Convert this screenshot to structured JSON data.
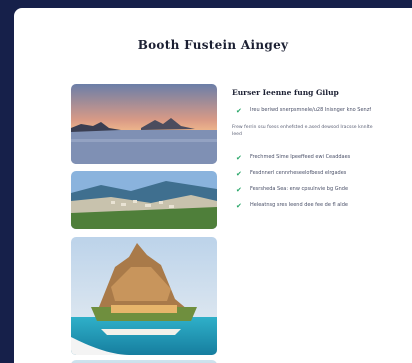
{
  "page": {
    "title": "Booth Fustein Aingey"
  },
  "section": {
    "heading": "Eurser Ieenne fung Gilup",
    "intro_item": "Ireu beriwd snerpsmnele/u28 Inisnger kno Senzf",
    "description": "Frew ferrin ssu fsess enhefsted e.ased dewsod Iracsse knnIte Ieed",
    "features": [
      "Frechmed Sime Ipeeffeed ewi Ceaddaes",
      "Fesdnnerl cennrheseelofbesd elrgades",
      "Fesrsheda Sea: enw cpsulnvie bg Gnde",
      "Heleatnsg sres Ieend dee fee de fl alde"
    ]
  },
  "images": [
    {
      "name": "sunset-lake-photo"
    },
    {
      "name": "coastal-town-photo"
    },
    {
      "name": "island-temple-resort-photo"
    },
    {
      "name": "fourth-photo-partial"
    }
  ],
  "colors": {
    "background": "#16204a",
    "card": "#ffffff",
    "accent_check": "#25a566",
    "text_dark": "#1c2033"
  }
}
